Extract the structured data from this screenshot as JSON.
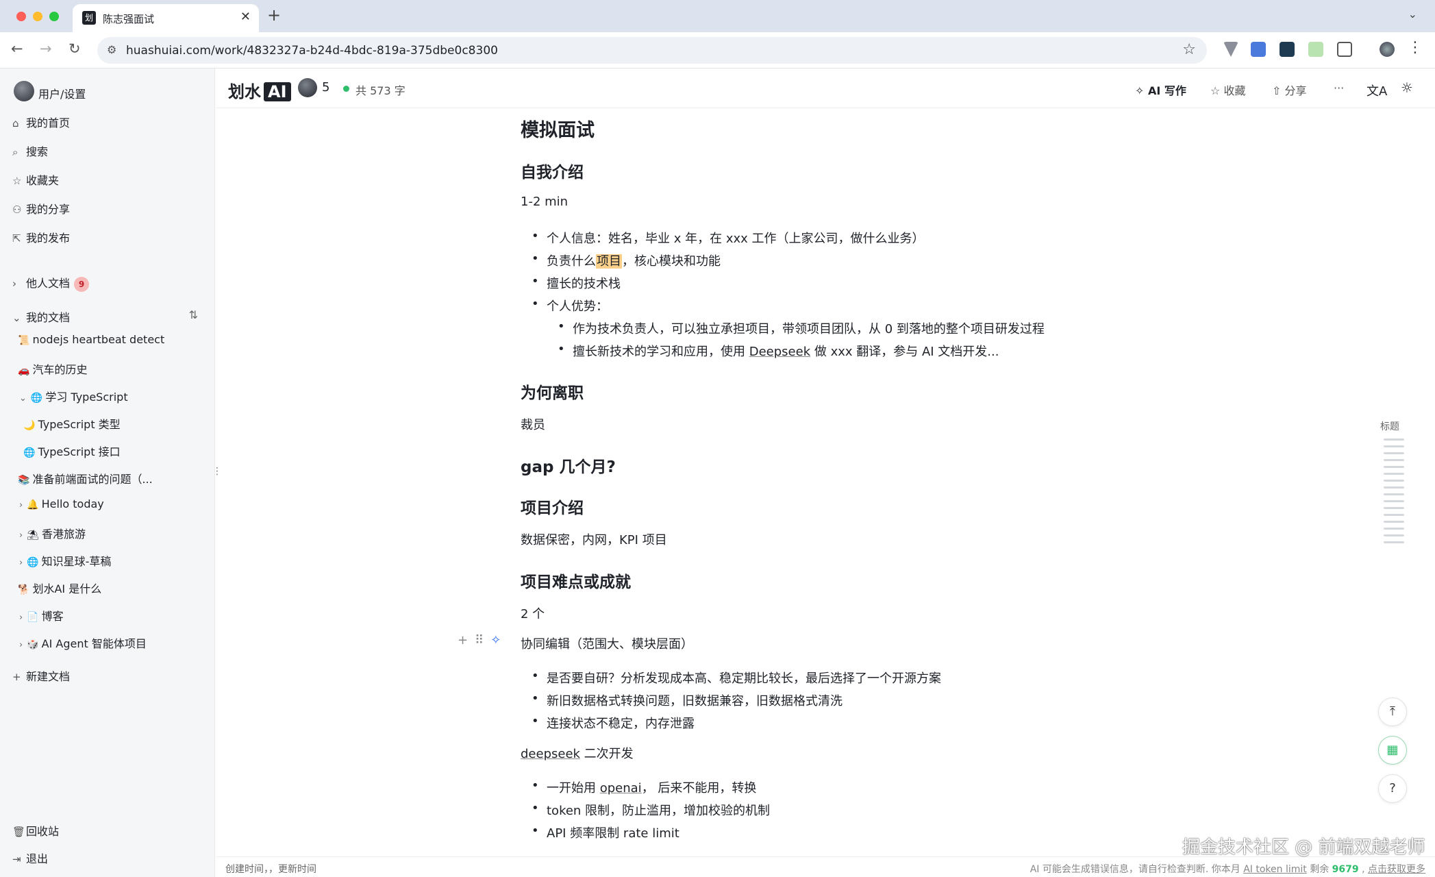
{
  "browser": {
    "tab_title": "陈志强面试",
    "tab_favicon": "划",
    "url": "huashuiai.com/work/4832327a-b24d-4bdc-819a-375dbe0c8300"
  },
  "sidebar": {
    "user": "用户/设置",
    "nav": [
      {
        "label": "我的首页",
        "icon": "home-icon"
      },
      {
        "label": "搜索",
        "icon": "search-icon"
      },
      {
        "label": "收藏夹",
        "icon": "star-icon"
      },
      {
        "label": "我的分享",
        "icon": "share-users-icon"
      },
      {
        "label": "我的发布",
        "icon": "external-link-icon"
      }
    ],
    "others_docs": "他人文档",
    "others_badge": "9",
    "my_docs": "我的文档",
    "docs": [
      "nodejs heartbeat detect",
      "汽车的历史",
      "学习 TypeScript",
      "TypeScript 类型",
      "TypeScript 接口",
      "准备前端面试的问题（...",
      "Hello today",
      "香港旅游",
      "知识星球-草稿",
      "划水AI 是什么",
      "博客",
      "AI Agent 智能体项目"
    ],
    "new_doc": "新建文档",
    "trash": "回收站",
    "logout": "退出"
  },
  "header": {
    "brand": "划水",
    "brand_ai": "AI",
    "collab_count": "5",
    "word_count": "共 573 字",
    "ai_write": "AI 写作",
    "favorite": "收藏",
    "share": "分享",
    "more": "···"
  },
  "doc": {
    "title": "模拟面试",
    "s1_title": "自我介绍",
    "s1_p": "1-2 min",
    "s1_li1": "个人信息：姓名，毕业 x 年，在 xxx 工作（上家公司，做什么业务）",
    "s1_li2_a": "负责什么",
    "s1_li2_hl": "项目",
    "s1_li2_b": "，核心模块和功能",
    "s1_li3": "擅长的技术栈",
    "s1_li4": "个人优势：",
    "s1_li4_1": "作为技术负责人，可以独立承担项目，带领项目团队，从 0 到落地的整个项目研发过程",
    "s1_li4_2_a": "擅长新技术的学习和应用，使用 ",
    "s1_li4_2_u": "Deepseek",
    "s1_li4_2_b": " 做 xxx 翻译，参与 AI 文档开发...",
    "s2_title": "为何离职",
    "s2_p": "裁员",
    "s3_title": "gap 几个月?",
    "s4_title": "项目介绍",
    "s4_p": "数据保密，内网，KPI 项目",
    "s5_title": "项目难点或成就",
    "s5_p": "2 个",
    "s5_p2": "协同编辑（范围大、模块层面）",
    "s5_li1": "是否要自研？分析发现成本高、稳定期比较长，最后选择了一个开源方案",
    "s5_li2": "新旧数据格式转换问题，旧数据兼容，旧数据格式清洗",
    "s5_li3": "连接状态不稳定，内存泄露",
    "s5_p3_u": "deepseek",
    "s5_p3_b": " 二次开发",
    "s5_li4_a": "一开始用 ",
    "s5_li4_u": "openai",
    "s5_li4_b": "， 后来不能用，转换",
    "s5_li5": "token 限制，防止滥用，增加校验的机制",
    "s5_li6": "API 频率限制 rate limit"
  },
  "right_rail": {
    "outline_label": "标题"
  },
  "footer": {
    "left": "创建时间，，更新时间",
    "right_a": "AI 可能会生成错误信息，请自行检查判断. 你本月 ",
    "right_link": "AI token limit",
    "right_b": " 剩余 ",
    "right_num": "9679",
    "right_c": " , ",
    "right_more": "点击获取更多"
  },
  "watermark": "掘金技术社区 @ 前端双越老师"
}
